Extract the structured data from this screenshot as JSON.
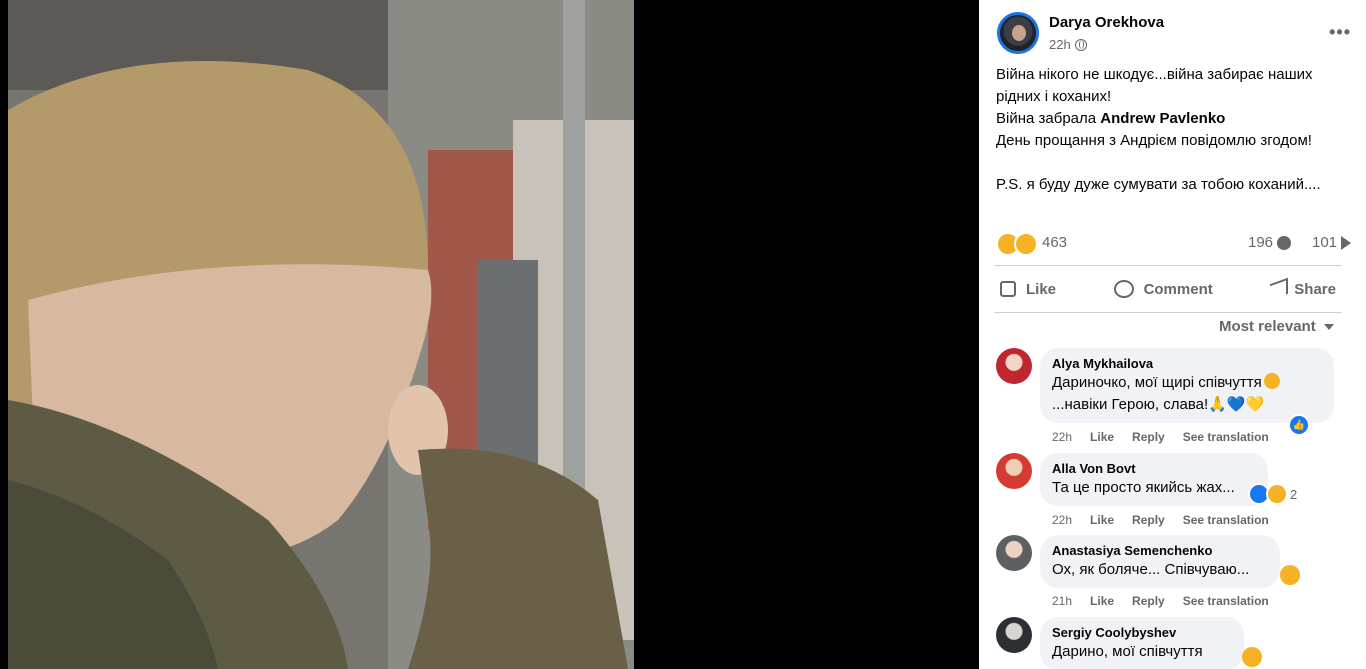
{
  "post": {
    "author": "Darya Orekhova",
    "time": "22h",
    "more_label": "•••",
    "text_line1": "Війна нікого не шкодує...війна забирає наших рідних і коханих!",
    "text_line2_prefix": "Війна забрала ",
    "text_line2_mention": "Andrew Pavlenko",
    "text_line3": "День прощання з Андрієм повідомлю згодом!",
    "text_line4": "P.S. я буду дуже сумувати за тобою коханий...."
  },
  "stats": {
    "reactions": "463",
    "comments": "196",
    "shares": "101"
  },
  "actions": {
    "like": "Like",
    "comment": "Comment",
    "share": "Share"
  },
  "sort": {
    "label": "Most relevant"
  },
  "comments": [
    {
      "name": "Alya Mykhailova",
      "line1": "Дариночко, мої щирі співчуття",
      "line2": "...навіки Герою, слава!🙏💙💛",
      "time": "22h",
      "like": "Like",
      "reply": "Reply",
      "translate": "See translation"
    },
    {
      "name": "Alla Von Bovt",
      "line1": "Та це просто якийсь жах...",
      "reaction_count": "2",
      "time": "22h",
      "like": "Like",
      "reply": "Reply",
      "translate": "See translation"
    },
    {
      "name": "Anastasiya Semenchenko",
      "line1": "Ох, як боляче... Співчуваю...",
      "time": "21h",
      "like": "Like",
      "reply": "Reply",
      "translate": "See translation"
    },
    {
      "name": "Sergiy Coolybyshev",
      "line1": "Дарино, мої співчуття",
      "time": "",
      "like": "",
      "reply": "",
      "translate": ""
    }
  ],
  "colors": {
    "accent": "#1877f2",
    "secondary_text": "#65676b",
    "bubble": "#f0f2f5"
  }
}
